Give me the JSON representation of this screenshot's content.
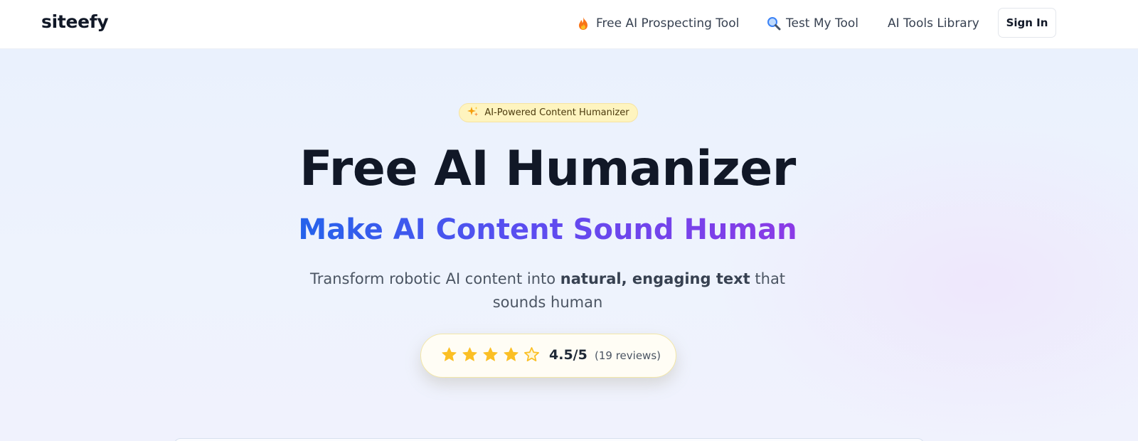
{
  "brand": {
    "logo": "siteefy"
  },
  "nav": {
    "items": [
      {
        "label": "Free AI Prospecting Tool",
        "icon": "fire-icon"
      },
      {
        "label": "Test My Tool",
        "icon": "magnifier-icon"
      },
      {
        "label": "AI Tools Library"
      }
    ],
    "signin_label": "Sign In"
  },
  "hero": {
    "badge": {
      "icon": "sparkles-icon",
      "label": "AI-Powered Content Humanizer"
    },
    "title": "Free AI Humanizer",
    "subtitle": "Make AI Content Sound Human",
    "description": {
      "before": "Transform robotic AI content into ",
      "emphasis": "natural, engaging text",
      "after": " that sounds human"
    },
    "rating": {
      "stars": 4.5,
      "max": 5,
      "score_label": "4.5/5",
      "count_label": "(19 reviews)"
    }
  },
  "colors": {
    "gradient_start": "#2563eb",
    "gradient_end": "#8b3ae6",
    "star": "#fbbf24",
    "badge_bg": "#fef4bf"
  }
}
